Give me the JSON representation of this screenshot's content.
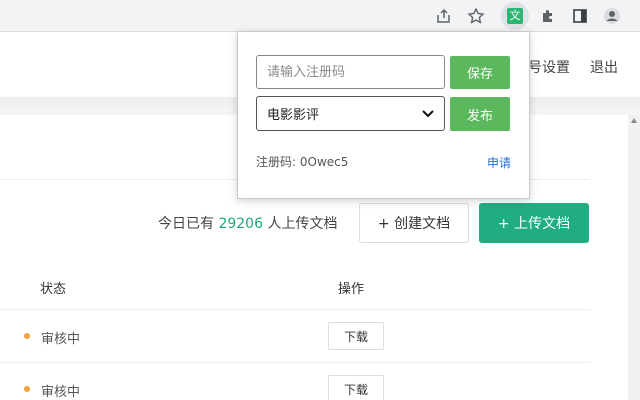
{
  "browser": {
    "icons": [
      "share-icon",
      "star-icon",
      "extension-wen-icon",
      "puzzle-icon",
      "sidepanel-icon",
      "profile-icon"
    ],
    "extension_glyph": "文",
    "extension_color": "#2bb673"
  },
  "header": {
    "account_settings_partial": "号设置",
    "logout": "退出"
  },
  "main": {
    "today_prefix": "今日已有 ",
    "today_count": "29206",
    "today_suffix": " 人上传文档",
    "create_button": "+ 创建文档",
    "upload_button": "+ 上传文档",
    "table": {
      "columns": [
        "状态",
        "操作"
      ],
      "rows": [
        {
          "status": "审核中",
          "action": "下载"
        },
        {
          "status": "审核中",
          "action": "下载"
        }
      ]
    }
  },
  "popup": {
    "reg_input_placeholder": "请输入注册码",
    "save_button": "保存",
    "category_selected": "电影影评",
    "publish_button": "发布",
    "reg_code_label": "注册码: 0Owec5",
    "apply_link": "申请"
  },
  "colors": {
    "accent_green": "#20ad82",
    "popup_button_green": "#5cb85c",
    "status_pending": "#f0a03c",
    "count_green": "#20a57d",
    "link_blue": "#2a6fd6"
  }
}
